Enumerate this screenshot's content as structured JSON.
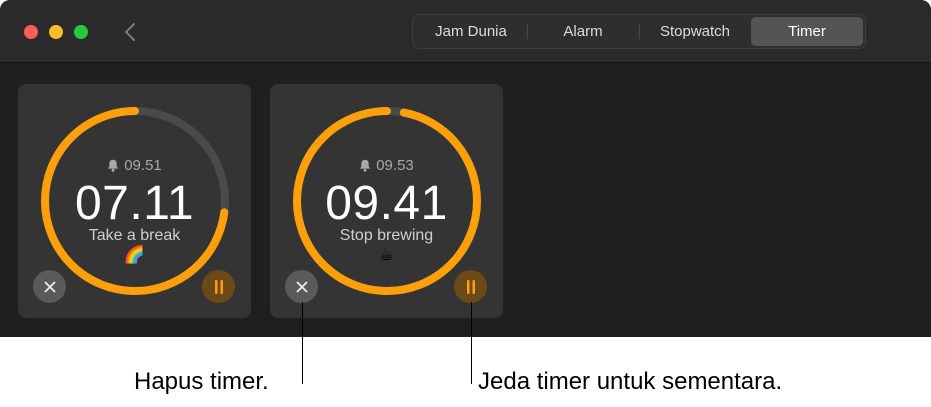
{
  "tabs": [
    "Jam Dunia",
    "Alarm",
    "Stopwatch",
    "Timer"
  ],
  "active_tab": "Timer",
  "timers": [
    {
      "alarm_time": "09.51",
      "remaining": "07.11",
      "label": "Take a break",
      "emoji": "🌈",
      "progress": 0.73
    },
    {
      "alarm_time": "09.53",
      "remaining": "09.41",
      "label": "Stop brewing",
      "emoji": "☕",
      "progress": 0.97
    }
  ],
  "callouts": {
    "cancel": "Hapus timer.",
    "pause": "Jeda timer untuk sementara."
  },
  "colors": {
    "ring_progress": "#ff9f0a",
    "ring_track": "#4a4a4a",
    "pause_icon": "#ff9f0a",
    "window_bg": "#1f1f1f"
  }
}
